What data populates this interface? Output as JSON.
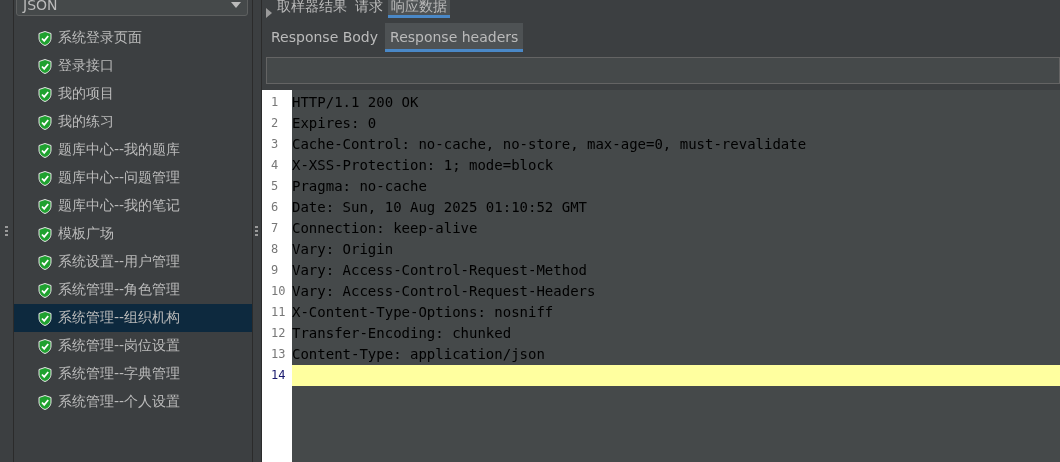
{
  "sidebar": {
    "dropdown": {
      "value": "JSON"
    },
    "items": [
      {
        "label": "系统登录页面",
        "selected": false
      },
      {
        "label": "登录接口",
        "selected": false
      },
      {
        "label": "我的项目",
        "selected": false
      },
      {
        "label": "我的练习",
        "selected": false
      },
      {
        "label": "题库中心--我的题库",
        "selected": false
      },
      {
        "label": "题库中心--问题管理",
        "selected": false
      },
      {
        "label": "题库中心--我的笔记",
        "selected": false
      },
      {
        "label": "模板广场",
        "selected": false
      },
      {
        "label": "系统设置--用户管理",
        "selected": false
      },
      {
        "label": "系统管理--角色管理",
        "selected": false
      },
      {
        "label": "系统管理--组织机构",
        "selected": true
      },
      {
        "label": "系统管理--岗位设置",
        "selected": false
      },
      {
        "label": "系统管理--字典管理",
        "selected": false
      },
      {
        "label": "系统管理--个人设置",
        "selected": false
      }
    ]
  },
  "tabs": [
    {
      "label": "取样器结果",
      "selected": false
    },
    {
      "label": "请求",
      "selected": false
    },
    {
      "label": "响应数据",
      "selected": true
    }
  ],
  "subtabs": [
    {
      "label": "Response Body",
      "selected": false
    },
    {
      "label": "Response headers",
      "selected": true
    }
  ],
  "editor": {
    "lines": [
      {
        "number": "1",
        "current": false,
        "text": "HTTP/1.1 200 OK"
      },
      {
        "number": "2",
        "current": false,
        "text": "Expires: 0"
      },
      {
        "number": "3",
        "current": false,
        "text": "Cache-Control: no-cache, no-store, max-age=0, must-revalidate"
      },
      {
        "number": "4",
        "current": false,
        "text": "X-XSS-Protection: 1; mode=block"
      },
      {
        "number": "5",
        "current": false,
        "text": "Pragma: no-cache"
      },
      {
        "number": "6",
        "current": false,
        "text": "Date: Sun, 10 Aug 2025 01:10:52 GMT"
      },
      {
        "number": "7",
        "current": false,
        "text": "Connection: keep-alive"
      },
      {
        "number": "8",
        "current": false,
        "text": "Vary: Origin"
      },
      {
        "number": "9",
        "current": false,
        "text": "Vary: Access-Control-Request-Method"
      },
      {
        "number": "10",
        "current": false,
        "text": "Vary: Access-Control-Request-Headers"
      },
      {
        "number": "11",
        "current": false,
        "text": "X-Content-Type-Options: nosniff"
      },
      {
        "number": "12",
        "current": false,
        "text": "Transfer-Encoding: chunked"
      },
      {
        "number": "13",
        "current": false,
        "text": "Content-Type: application/json"
      },
      {
        "number": "14",
        "current": true
      }
    ]
  }
}
